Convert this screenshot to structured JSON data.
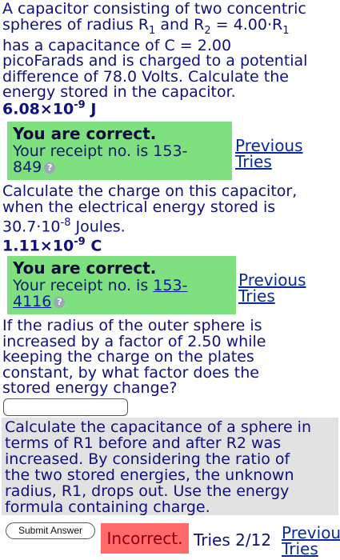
{
  "question1": {
    "line1": "A capacitor consisting of two concentric",
    "line2_pre": "spheres of radius R",
    "line2_sub1": "1",
    "line2_mid": " and R",
    "line2_sub2": "2",
    "line2_post": " = 4.00·R",
    "line2_sub3": "1",
    "line3": "has a capacitance of C = 2.00",
    "line4": "picoFarads and is charged to a potential",
    "line5": "difference of 78.0 Volts. Calculate the",
    "line6": "energy stored in the capacitor.",
    "answer_base": "6.08×10",
    "answer_exp": "-9",
    "answer_unit": " J"
  },
  "feedback1": {
    "title": "You are correct.",
    "receipt_line1": "Your receipt no. is 153-",
    "receipt_line2": "849",
    "help_icon": "?",
    "previous_line1": "Previous",
    "previous_line2": "Tries"
  },
  "question2": {
    "line1": "Calculate the charge on this capacitor,",
    "line2": "when the electrical energy stored is",
    "line3_pre": "30.7·10",
    "line3_exp": "-8",
    "line3_post": " Joules.",
    "answer_base": "1.11×10",
    "answer_exp": "-9",
    "answer_unit": " C"
  },
  "feedback2": {
    "title": "You are correct.",
    "receipt_prefix": "Your receipt no. is ",
    "receipt_num1": "153-",
    "receipt_num2": "4116",
    "help_icon": "?",
    "previous_line1": "Previous",
    "previous_line2": "Tries"
  },
  "question3": {
    "line1": "If the radius of the outer sphere is",
    "line2": "increased by a factor of 2.50 while",
    "line3": "keeping the charge on the plates",
    "line4": "constant, by what factor does the",
    "line5": "stored energy change?",
    "input_value": ""
  },
  "hint": {
    "line1": "Calculate the capacitance of a sphere in",
    "line2": "terms of R1 before and after R2 was",
    "line3": "increased. By considering the ratio of",
    "line4": "the two stored energies, the unknown",
    "line5": "radius, R1, drops out. Use the energy",
    "line6": "formula containing charge."
  },
  "footer": {
    "submit_label": "Submit Answer",
    "status": "Incorrect.",
    "tries": "Tries 2/12",
    "previous_line1": "Previou",
    "previous_line2": "Tries"
  },
  "colors": {
    "correct_bg": "#7ee07e",
    "incorrect_bg": "#ff6b6b",
    "hint_bg": "#e2e2e2",
    "text": "#10107c"
  }
}
